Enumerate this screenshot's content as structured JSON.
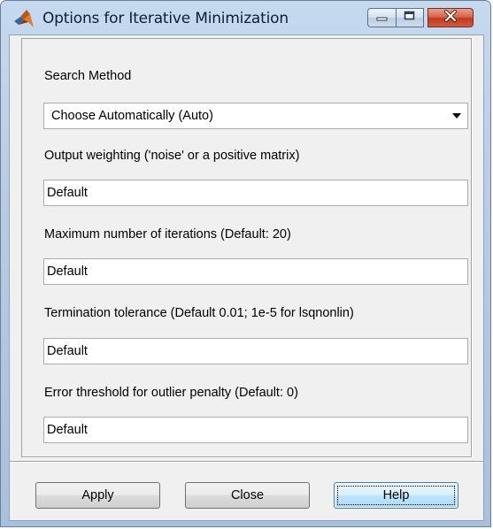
{
  "window": {
    "title": "Options for Iterative Minimization",
    "app_icon": "matlab-logo-icon",
    "controls": {
      "minimize_icon": "minimize-icon",
      "maximize_icon": "maximize-icon",
      "close_icon": "close-icon",
      "close_color": "#c2391d"
    }
  },
  "form": {
    "search_method": {
      "label": "Search Method",
      "selected": "Choose Automatically (Auto)"
    },
    "output_weighting": {
      "label": "Output weighting ('noise' or a positive matrix)",
      "value": "Default"
    },
    "max_iterations": {
      "label": "Maximum number of iterations (Default: 20)",
      "value": "Default"
    },
    "termination_tolerance": {
      "label": "Termination tolerance (Default 0.01; 1e-5 for lsqnonlin)",
      "value": "Default"
    },
    "error_threshold": {
      "label": "Error threshold for outlier penalty (Default: 0)",
      "value": "Default"
    }
  },
  "buttons": {
    "apply": "Apply",
    "close": "Close",
    "help": "Help",
    "focused": "help"
  }
}
